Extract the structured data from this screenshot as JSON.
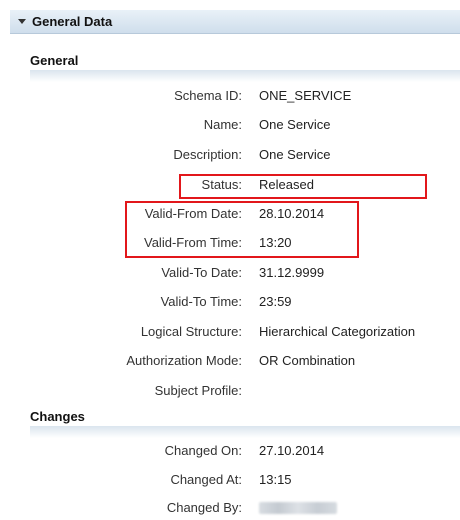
{
  "panel": {
    "title": "General Data"
  },
  "sections": {
    "general": "General",
    "changes": "Changes"
  },
  "general_fields": {
    "schema_id": {
      "label": "Schema ID:",
      "value": "ONE_SERVICE"
    },
    "name": {
      "label": "Name:",
      "value": "One Service"
    },
    "description": {
      "label": "Description:",
      "value": "One Service"
    },
    "status": {
      "label": "Status:",
      "value": "Released"
    },
    "valid_from_date": {
      "label": "Valid-From Date:",
      "value": "28.10.2014"
    },
    "valid_from_time": {
      "label": "Valid-From Time:",
      "value": "13:20"
    },
    "valid_to_date": {
      "label": "Valid-To Date:",
      "value": "31.12.9999"
    },
    "valid_to_time": {
      "label": "Valid-To Time:",
      "value": "23:59"
    },
    "logical_structure": {
      "label": "Logical Structure:",
      "value": "Hierarchical Categorization"
    },
    "authorization_mode": {
      "label": "Authorization Mode:",
      "value": "OR Combination"
    },
    "subject_profile": {
      "label": "Subject Profile:",
      "value": ""
    }
  },
  "change_fields": {
    "changed_on": {
      "label": "Changed On:",
      "value": "27.10.2014"
    },
    "changed_at": {
      "label": "Changed At:",
      "value": "13:15"
    },
    "changed_by": {
      "label": "Changed By:"
    }
  },
  "colors": {
    "highlight": "#e2171b",
    "header_bg": "#cfdeec"
  }
}
